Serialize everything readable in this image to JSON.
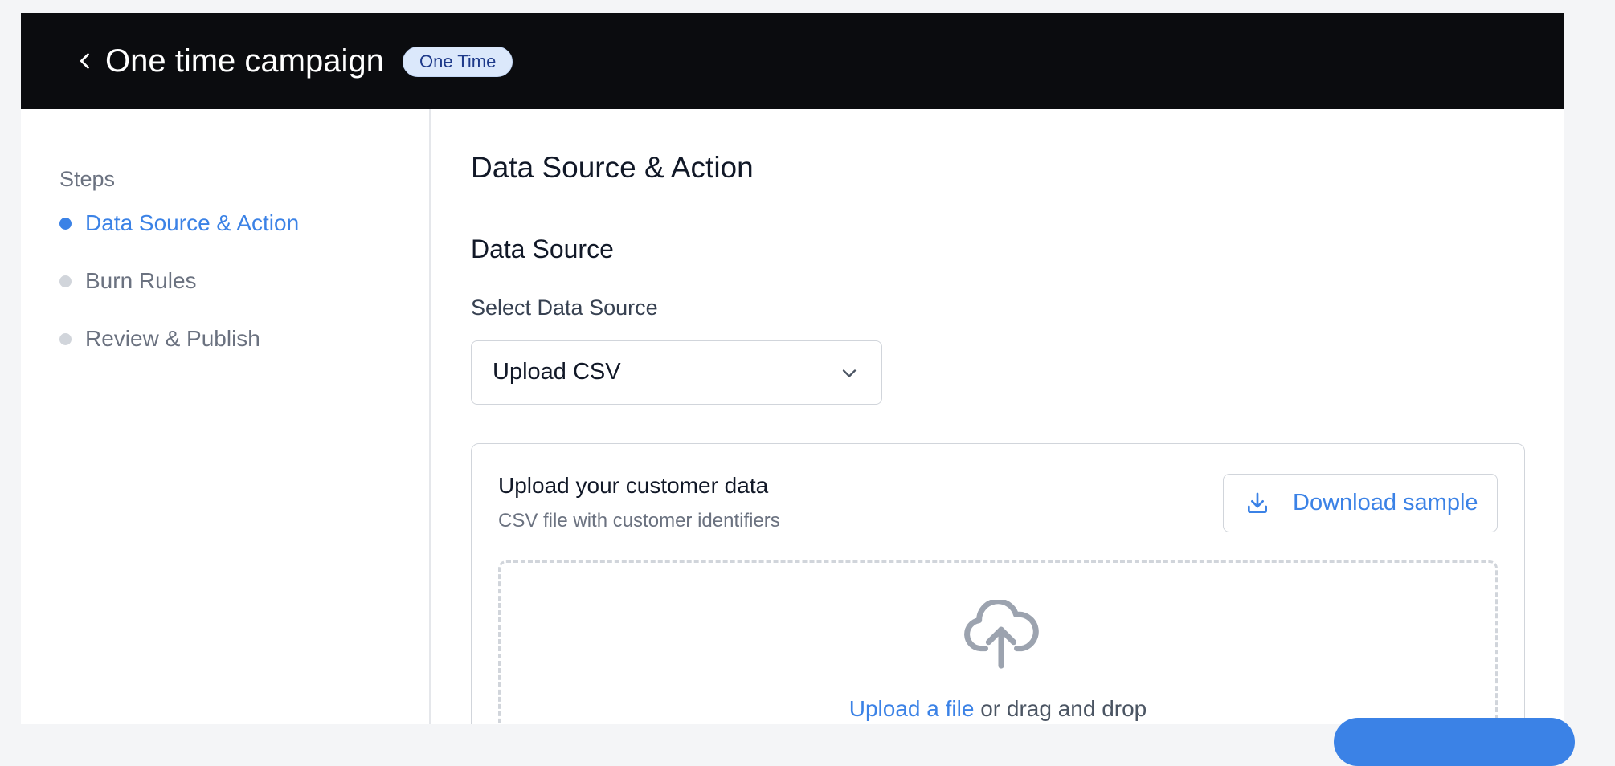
{
  "header": {
    "title": "One time campaign",
    "badge": "One Time"
  },
  "sidebar": {
    "heading": "Steps",
    "steps": [
      {
        "label": "Data Source & Action",
        "active": true
      },
      {
        "label": "Burn Rules",
        "active": false
      },
      {
        "label": "Review & Publish",
        "active": false
      }
    ]
  },
  "main": {
    "page_heading": "Data Source & Action",
    "section_heading": "Data Source",
    "field_label": "Select Data Source",
    "select_value": "Upload CSV",
    "upload": {
      "title": "Upload your customer data",
      "subtitle": "CSV file with customer identifiers",
      "download_label": "Download sample",
      "link_text": "Upload a file",
      "drop_text": " or drag and drop"
    }
  },
  "colors": {
    "accent": "#3b82e6",
    "header_bg": "#0b0c0f",
    "badge_bg": "#dbe8fb"
  },
  "icons": [
    "chevron-left-icon",
    "chevron-down-icon",
    "download-icon",
    "cloud-upload-icon"
  ]
}
